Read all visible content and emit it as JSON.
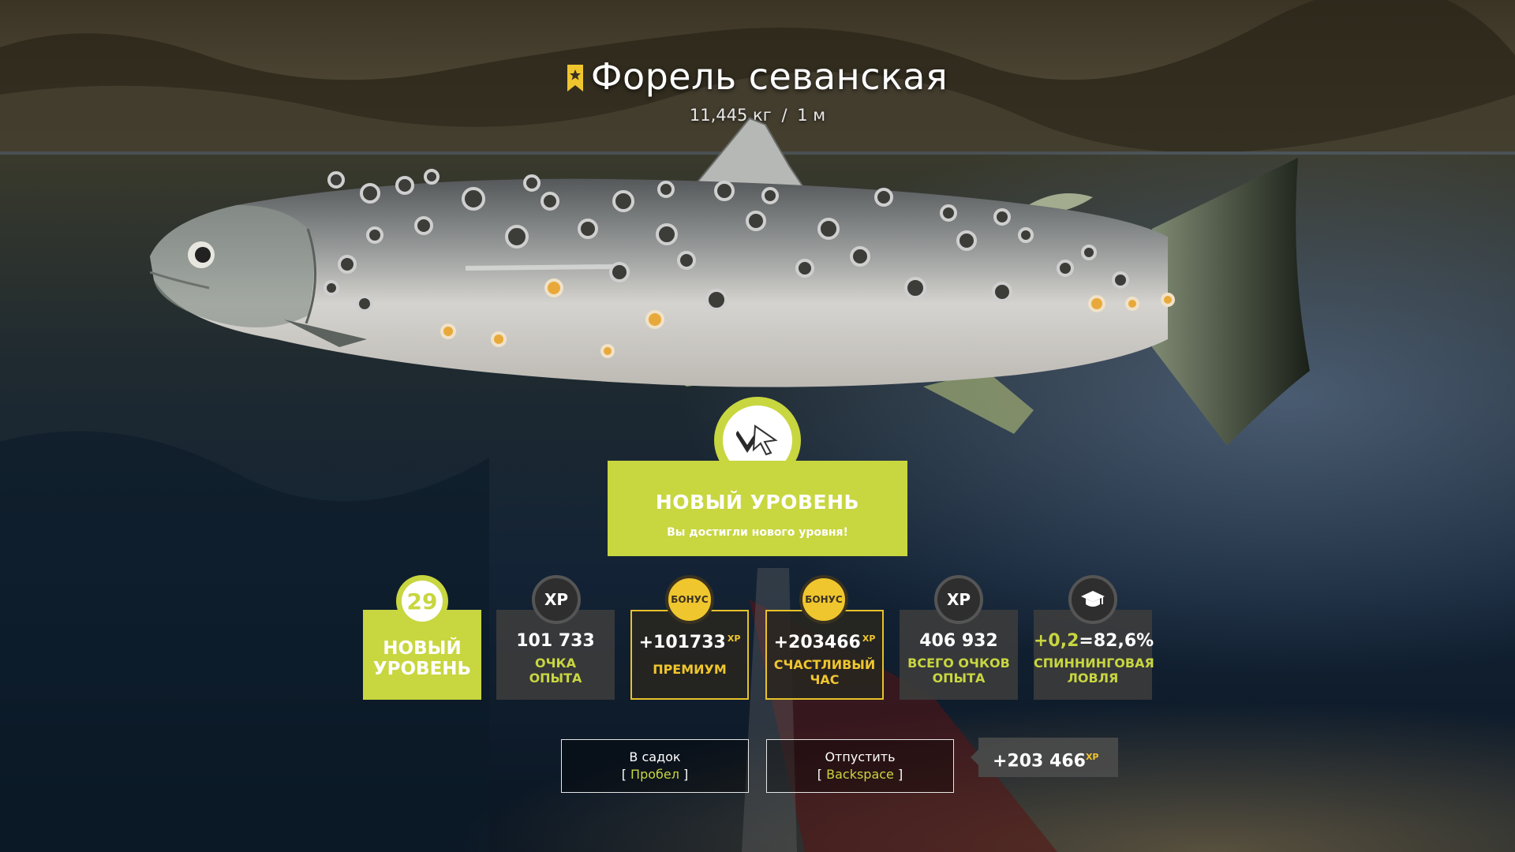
{
  "fish": {
    "name": "Форель севанская",
    "weight": "11,445 кг",
    "separator": "/",
    "length": "1 м"
  },
  "level_up": {
    "title": "НОВЫЙ УРОВЕНЬ",
    "subtitle": "Вы достигли нового уровня!"
  },
  "cards": [
    {
      "badge": "29",
      "line1": "НОВЫЙ",
      "line2": "УРОВЕНЬ"
    },
    {
      "badge": "XP",
      "value": "101 733",
      "line1": "ОЧКА",
      "line2": "ОПЫТА"
    },
    {
      "badge": "БОНУС",
      "value": "+101733",
      "sup": "XP",
      "line1": "ПРЕМИУМ"
    },
    {
      "badge": "БОНУС",
      "value": "+203466",
      "sup": "XP",
      "line1": "СЧАСТЛИВЫЙ",
      "line2": "ЧАС"
    },
    {
      "badge": "XP",
      "value": "406 932",
      "line1": "ВСЕГО ОЧКОВ",
      "line2": "ОПЫТА"
    },
    {
      "plus": "+0,2",
      "eq": "=",
      "value": "82,6%",
      "line1": "СПИННИНГОВАЯ",
      "line2": "ЛОВЛЯ"
    }
  ],
  "buttons": {
    "keep": {
      "label": "В садок",
      "key": "Пробел"
    },
    "release": {
      "label": "Отпустить",
      "key": "Backspace"
    }
  },
  "xp_total": {
    "value": "+203 466",
    "sup": "XP"
  },
  "colors": {
    "accent": "#c8d640",
    "bonus": "#f0c62e"
  }
}
